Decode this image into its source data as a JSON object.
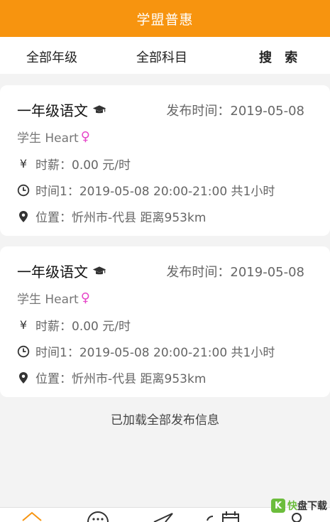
{
  "header": {
    "title": "学盟普惠"
  },
  "filters": {
    "grade": "全部年级",
    "subject": "全部科目",
    "search": "搜 索"
  },
  "cards": [
    {
      "course": "一年级语文",
      "publish_time": "发布时间：2019-05-08",
      "student": "学生 Heart",
      "gender_symbol": "♀",
      "salary": "时薪：0.00 元/时",
      "time": "时间1：2019-05-08 20:00-21:00 共1小时",
      "location": "位置：忻州市-代县 距离953km"
    },
    {
      "course": "一年级语文",
      "publish_time": "发布时间：2019-05-08",
      "student": "学生 Heart",
      "gender_symbol": "♀",
      "salary": "时薪：0.00 元/时",
      "time": "时间1：2019-05-08 20:00-21:00 共1小时",
      "location": "位置：忻州市-代县 距离953km"
    }
  ],
  "footer_message": "已加载全部发布信息",
  "icons": {
    "salary": "¥",
    "graduation": "graduation-cap-icon",
    "clock": "clock-icon",
    "location": "location-pin-icon"
  },
  "watermark": {
    "logo": "K",
    "text_green": "快",
    "text_dark": "盘下载"
  },
  "colors": {
    "accent": "#f7940f",
    "female": "#e645c9",
    "watermark": "#6cbd3c"
  }
}
